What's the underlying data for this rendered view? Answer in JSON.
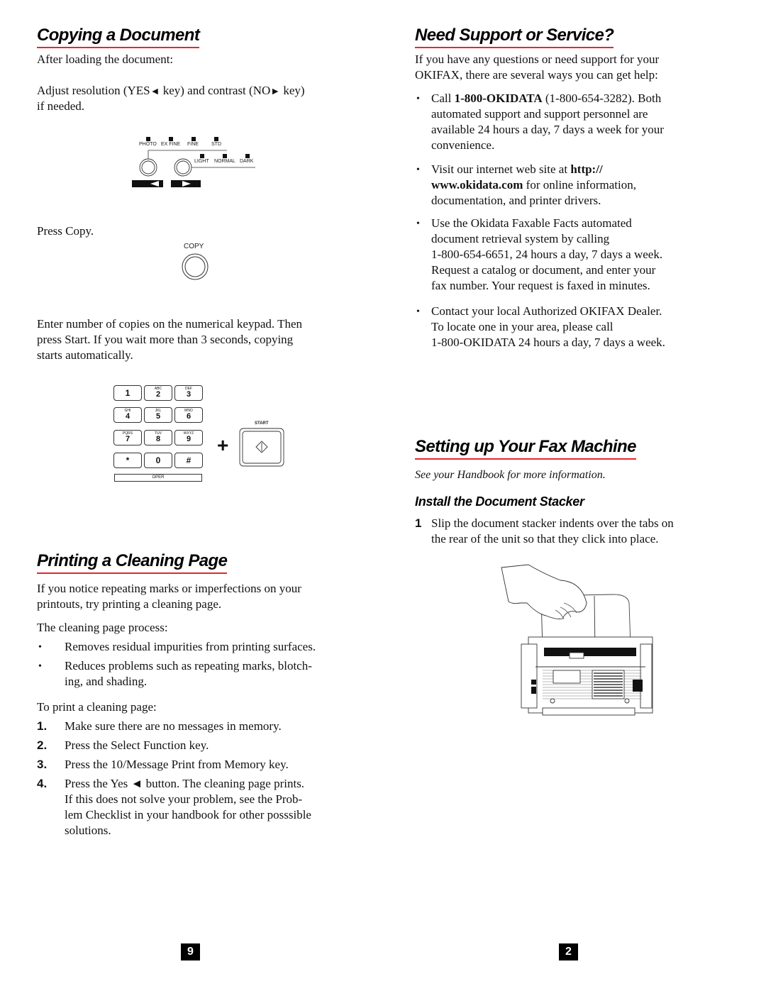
{
  "copying": {
    "heading": "Copying a Document",
    "after_loading": "After loading the document:",
    "adjust_1": "Adjust resolution (YES",
    "adjust_2": " key) and contrast (NO",
    "adjust_3": " key)",
    "adjust_4": "if needed.",
    "panel": {
      "resolution_labels": [
        "PHOTO",
        "EX FINE",
        "FINE",
        "STD"
      ],
      "contrast_labels": [
        "LIGHT",
        "NORMAL",
        "DARK"
      ],
      "yes_arrow": "◄",
      "no_arrow": "►"
    },
    "press_copy": "Press Copy.",
    "copy_label": "COPY",
    "enter_number": [
      "Enter number of copies on the numerical keypad.  Then",
      "press Start. If you wait more than 3 seconds, copying",
      "starts automatically."
    ],
    "keypad": [
      {
        "main": "1",
        "sub": ""
      },
      {
        "main": "2",
        "sub": "ABC"
      },
      {
        "main": "3",
        "sub": "DEF"
      },
      {
        "main": "4",
        "sub": "GHI"
      },
      {
        "main": "5",
        "sub": "JKL"
      },
      {
        "main": "6",
        "sub": "MNO"
      },
      {
        "main": "7",
        "sub": "PQRS"
      },
      {
        "main": "8",
        "sub": "TUV"
      },
      {
        "main": "9",
        "sub": "WXYZ"
      },
      {
        "main": "*",
        "sub": ""
      },
      {
        "main": "0",
        "sub": ""
      },
      {
        "main": "#",
        "sub": ""
      }
    ],
    "oper_label": "OPER",
    "plus": "+",
    "start_label": "START"
  },
  "cleaning": {
    "heading": "Printing a Cleaning Page",
    "intro": [
      "If you notice repeating marks or imperfections on your",
      "printouts, try printing a cleaning page."
    ],
    "process_label": "The cleaning page process:",
    "bullets": [
      [
        "Removes residual impurities from printing surfaces."
      ],
      [
        "Reduces problems such as repeating marks, blotch-",
        "ing, and shading."
      ]
    ],
    "to_print": "To print a cleaning page:",
    "steps": [
      {
        "num": "1.",
        "lines": [
          "Make sure there are no messages in memory."
        ]
      },
      {
        "num": "2.",
        "lines": [
          "Press the Select Function key."
        ]
      },
      {
        "num": "3.",
        "lines": [
          "Press the 10/Message Print from Memory key."
        ]
      },
      {
        "num": "4.",
        "lines": [
          "Press the Yes ◄ button. The cleaning page prints.",
          "If this does not solve your problem, see the Prob-",
          "lem Checklist in your handbook for other posssible",
          "solutions."
        ]
      }
    ]
  },
  "support": {
    "heading": "Need Support or Service?",
    "intro": [
      "If you have any questions or need support for your",
      "OKIFAX, there are several ways you can get help:"
    ],
    "call_pre": "Call ",
    "call_bold": "1-800-OKIDATA",
    "call_post": " (1-800-654-3282).  Both",
    "call_rest": [
      "automated support and support personnel are",
      "available 24 hours a day, 7 days a week for your",
      "convenience."
    ],
    "web_pre": "Visit our internet web site at ",
    "web_bold_1": "http://",
    "web_bold_2": "www.okidata.com",
    "web_post": " for online information,",
    "web_rest": "documentation, and printer drivers.",
    "faxable": [
      "Use the Okidata Faxable Facts automated",
      "document retrieval system by calling",
      "1-800-654-6651, 24 hours a day, 7 days a week.",
      "Request a catalog or document, and enter your",
      "fax number.  Your request is faxed in minutes."
    ],
    "dealer": [
      "Contact your local Authorized OKIFAX Dealer.",
      "To locate one in your area, please call",
      "1-800-OKIDATA 24 hours a day, 7 days a week."
    ]
  },
  "setup": {
    "heading": "Setting up Your Fax Machine",
    "see_handbook": "See your Handbook for more information.",
    "subheading": "Install the Document Stacker",
    "step_num": "1",
    "step_lines": [
      "Slip the document stacker indents over the tabs on",
      "the rear of the unit so that they click into place."
    ]
  },
  "footer": {
    "left_page": "9",
    "right_page": "2"
  },
  "colors": {
    "heading_rule": "#e8262b"
  }
}
